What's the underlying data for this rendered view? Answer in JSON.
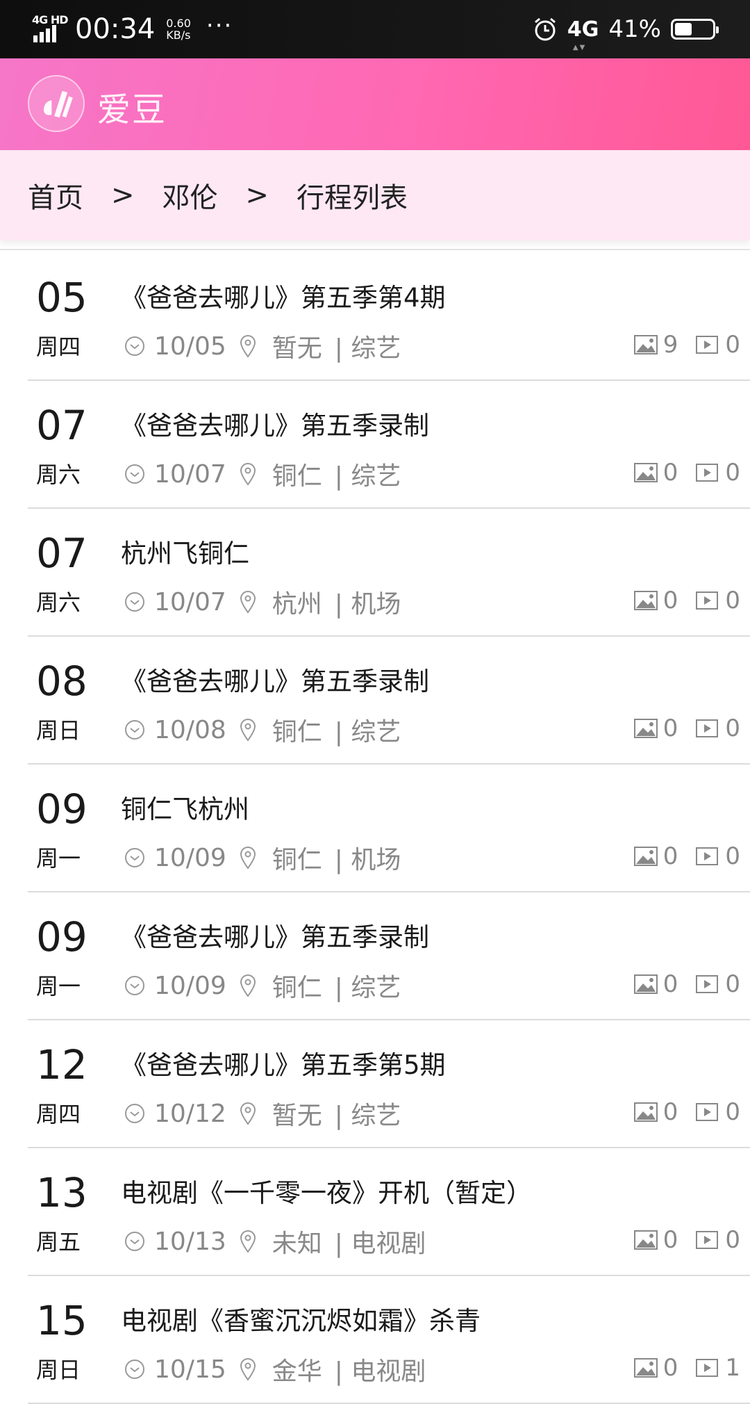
{
  "status_bar": {
    "network_label": "4G HD",
    "time": "00:34",
    "speed_value": "0.60",
    "speed_unit": "KB/s",
    "more": "···",
    "mobile_data": "4G",
    "battery_percent": "41%",
    "battery_level": 0.41,
    "icons": [
      "signal-icon",
      "alarm-icon",
      "battery-icon"
    ]
  },
  "header": {
    "app_name": "爱豆",
    "accent_color": "#ff68b2"
  },
  "breadcrumb": {
    "items": [
      "首页",
      "邓伦",
      "行程列表"
    ],
    "separator": ">"
  },
  "schedule": [
    {
      "day": "05",
      "weekday": "周四",
      "title": "《爸爸去哪儿》第五季第4期",
      "date": "10/05",
      "location": "暂无",
      "category": "| 综艺",
      "photos": "9",
      "videos": "0"
    },
    {
      "day": "07",
      "weekday": "周六",
      "title": "《爸爸去哪儿》第五季录制",
      "date": "10/07",
      "location": "铜仁",
      "category": "| 综艺",
      "photos": "0",
      "videos": "0"
    },
    {
      "day": "07",
      "weekday": "周六",
      "title": "杭州飞铜仁",
      "date": "10/07",
      "location": "杭州",
      "category": "| 机场",
      "photos": "0",
      "videos": "0"
    },
    {
      "day": "08",
      "weekday": "周日",
      "title": "《爸爸去哪儿》第五季录制",
      "date": "10/08",
      "location": "铜仁",
      "category": "| 综艺",
      "photos": "0",
      "videos": "0"
    },
    {
      "day": "09",
      "weekday": "周一",
      "title": "铜仁飞杭州",
      "date": "10/09",
      "location": "铜仁",
      "category": "| 机场",
      "photos": "0",
      "videos": "0"
    },
    {
      "day": "09",
      "weekday": "周一",
      "title": "《爸爸去哪儿》第五季录制",
      "date": "10/09",
      "location": "铜仁",
      "category": "| 综艺",
      "photos": "0",
      "videos": "0"
    },
    {
      "day": "12",
      "weekday": "周四",
      "title": "《爸爸去哪儿》第五季第5期",
      "date": "10/12",
      "location": "暂无",
      "category": "| 综艺",
      "photos": "0",
      "videos": "0"
    },
    {
      "day": "13",
      "weekday": "周五",
      "title": "电视剧《一千零一夜》开机（暂定）",
      "date": "10/13",
      "location": "未知",
      "category": "| 电视剧",
      "photos": "0",
      "videos": "0"
    },
    {
      "day": "15",
      "weekday": "周日",
      "title": "电视剧《香蜜沉沉烬如霜》杀青",
      "date": "10/15",
      "location": "金华",
      "category": "| 电视剧",
      "photos": "0",
      "videos": "1"
    }
  ]
}
